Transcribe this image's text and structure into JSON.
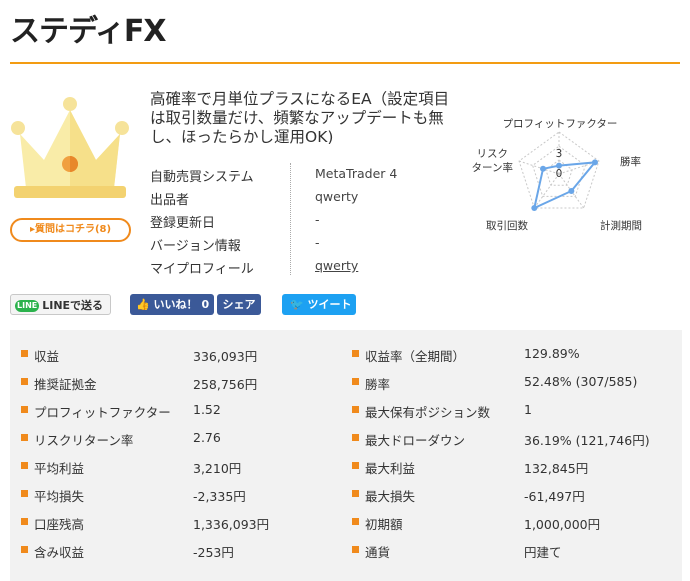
{
  "page": {
    "title": "ステディFX",
    "description": "高確率で月単位プラスになるEA（設定項目は取引数量だけ、頻繁なアップデートも無し、ほったらかし運用OK)"
  },
  "question_button": "▸質問はコチラ(8)",
  "info": [
    {
      "label": "自動売買システム",
      "value": "MetaTrader 4"
    },
    {
      "label": "出品者",
      "value": "qwerty"
    },
    {
      "label": "登録更新日",
      "value": "-"
    },
    {
      "label": "バージョン情報",
      "value": "-"
    },
    {
      "label": "マイプロフィール",
      "value": "qwerty"
    }
  ],
  "radar": {
    "axes": [
      "プロフィットファクター",
      "勝率",
      "計測期間",
      "取引回数",
      "リスク\nターン率"
    ],
    "axis_labels": {
      "top": "プロフィットファクター",
      "right": "勝率",
      "bottom_right": "計測期間",
      "bottom_left": "取引回数",
      "left_line1": "リスク",
      "left_line2": "ターン率"
    },
    "scale_labels": [
      "3",
      "0"
    ],
    "values": [
      0.2,
      0.9,
      0.5,
      1.0,
      0.4
    ],
    "color": "#6aa6e8"
  },
  "social": {
    "line": "LINEで送る",
    "line_badge": "LINE",
    "like": "いいね！",
    "like_count": "0",
    "share": "シェア",
    "tweet": "ツイート"
  },
  "stats_left": [
    {
      "label": "収益",
      "value": "336,093円"
    },
    {
      "label": "推奨証拠金",
      "value": "258,756円"
    },
    {
      "label": "プロフィットファクター",
      "value": "1.52"
    },
    {
      "label": "リスクリターン率",
      "value": "2.76"
    },
    {
      "label": "平均利益",
      "value": "3,210円"
    },
    {
      "label": "平均損失",
      "value": "-2,335円"
    },
    {
      "label": "口座残高",
      "value": "1,336,093円"
    },
    {
      "label": "含み収益",
      "value": "-253円"
    }
  ],
  "stats_right": [
    {
      "label": "収益率（全期間）",
      "value": "129.89%"
    },
    {
      "label": "勝率",
      "value": "52.48% (307/585)"
    },
    {
      "label": "最大保有ポジション数",
      "value": "1"
    },
    {
      "label": "最大ドローダウン",
      "value": "36.19% (121,746円)"
    },
    {
      "label": "最大利益",
      "value": "132,845円"
    },
    {
      "label": "最大損失",
      "value": "-61,497円"
    },
    {
      "label": "初期額",
      "value": "1,000,000円"
    },
    {
      "label": "通貨",
      "value": "円建て"
    }
  ],
  "colors": {
    "accent": "#f08a1c",
    "facebook": "#3b5998",
    "twitter": "#1da1f2",
    "line": "#2bb24c"
  }
}
